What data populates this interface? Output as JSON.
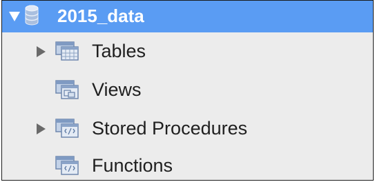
{
  "tree": {
    "schema": {
      "label": "2015_data",
      "icon": "database-icon",
      "expanded": true,
      "selected": true,
      "highlight_color": "#5a9cf3"
    },
    "items": [
      {
        "label": "Tables",
        "icon": "tables-folder-icon",
        "has_children": true
      },
      {
        "label": "Views",
        "icon": "views-folder-icon",
        "has_children": false
      },
      {
        "label": "Stored Procedures",
        "icon": "stored-procedures-folder-icon",
        "has_children": true
      },
      {
        "label": "Functions",
        "icon": "functions-folder-icon",
        "has_children": false
      }
    ]
  }
}
